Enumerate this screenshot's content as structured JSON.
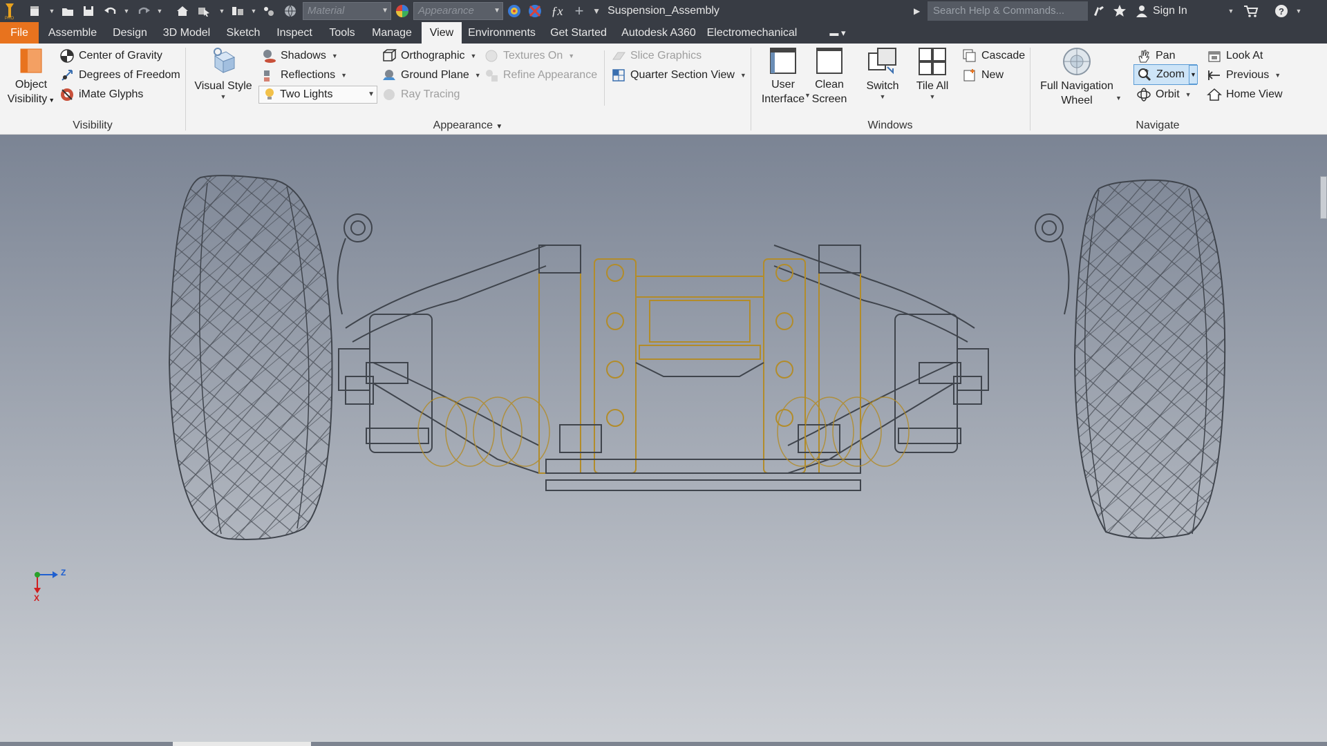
{
  "quick_access": {
    "material_placeholder": "Material",
    "appearance_placeholder": "Appearance",
    "icons": [
      "inventor-logo-icon",
      "new-icon",
      "open-icon",
      "save-icon",
      "undo-icon",
      "redo-icon",
      "home-icon",
      "select-icon",
      "measure-icon",
      "color-icon",
      "clear-appearance-icon",
      "function-icon",
      "plus-icon",
      "customize-icon"
    ]
  },
  "window": {
    "title": "Suspension_Assembly",
    "search_placeholder": "Search Help & Commands...",
    "sign_in": "Sign In"
  },
  "tabs": [
    {
      "label": "File",
      "state": "file"
    },
    {
      "label": "Assemble",
      "state": ""
    },
    {
      "label": "Design",
      "state": ""
    },
    {
      "label": "3D Model",
      "state": ""
    },
    {
      "label": "Sketch",
      "state": ""
    },
    {
      "label": "Inspect",
      "state": ""
    },
    {
      "label": "Tools",
      "state": ""
    },
    {
      "label": "Manage",
      "state": ""
    },
    {
      "label": "View",
      "state": "active"
    },
    {
      "label": "Environments",
      "state": ""
    },
    {
      "label": "Get Started",
      "state": ""
    },
    {
      "label": "Autodesk A360",
      "state": ""
    },
    {
      "label": "Electromechanical",
      "state": ""
    }
  ],
  "ribbon": {
    "visibility": {
      "title": "Visibility",
      "object_visibility_line1": "Object",
      "object_visibility_line2": "Visibility",
      "center_of_gravity": "Center of Gravity",
      "degrees_of_freedom": "Degrees of Freedom",
      "imate_glyphs": "iMate Glyphs"
    },
    "appearance": {
      "title": "Appearance",
      "visual_style": "Visual Style",
      "shadows": "Shadows",
      "reflections": "Reflections",
      "lighting_value": "Two Lights",
      "orthographic": "Orthographic",
      "ground_plane": "Ground Plane",
      "ray_tracing": "Ray Tracing",
      "textures_on": "Textures On",
      "refine_appearance": "Refine Appearance",
      "slice_graphics": "Slice Graphics",
      "quarter_section_view": "Quarter Section View"
    },
    "windows": {
      "title": "Windows",
      "user_interface_line1": "User",
      "user_interface_line2": "Interface",
      "clean_screen_line1": "Clean",
      "clean_screen_line2": "Screen",
      "switch": "Switch",
      "tile_all": "Tile All",
      "cascade": "Cascade",
      "new": "New"
    },
    "navigate": {
      "title": "Navigate",
      "full_nav_wheel_line1": "Full Navigation",
      "full_nav_wheel_line2": "Wheel",
      "pan": "Pan",
      "zoom": "Zoom",
      "orbit": "Orbit",
      "look_at": "Look At",
      "previous": "Previous",
      "home_view": "Home View"
    }
  },
  "viewport": {
    "axis_z": "Z",
    "axis_x": "X",
    "colors": {
      "wire": "#3f444c",
      "frame": "#b28c2a",
      "accent_orange": "#e8731e",
      "axis_z": "#1f5fd0",
      "axis_x": "#d01f1f",
      "axis_y": "#2aa02a"
    }
  }
}
